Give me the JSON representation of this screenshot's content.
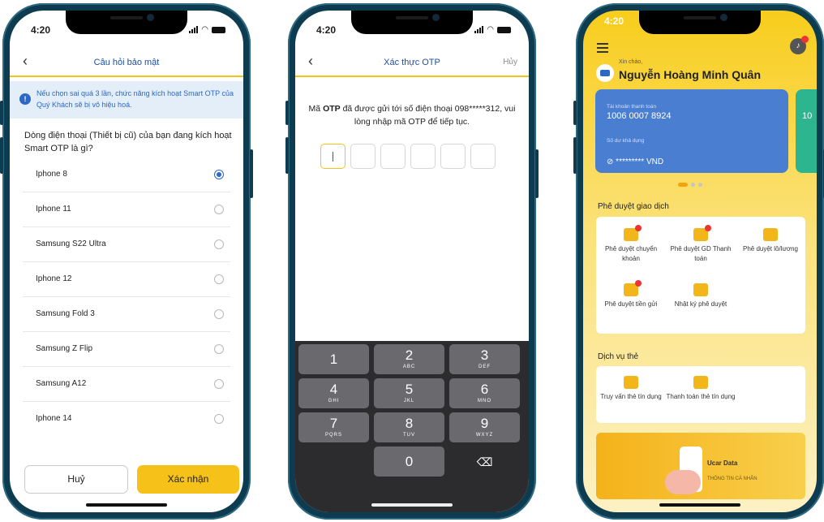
{
  "phone1": {
    "time": "4:20",
    "title": "Câu hỏi bảo mật",
    "info": "Nếu chọn sai quá 3 lần, chức năng kích hoạt Smart OTP của Quý Khách sẽ bị vô hiệu hoá.",
    "question": "Dòng điện thoại (Thiết bị cũ) của bạn đang kích hoạt Smart OTP là gì?",
    "options": [
      "Iphone 8",
      "Iphone 11",
      "Samsung S22 Ultra",
      "Iphone 12",
      "Samsung Fold 3",
      "Samsung Z Flip",
      "Samsung A12",
      "Iphone 14"
    ],
    "selected_option": "Iphone 8",
    "cancel_label": "Huỷ",
    "confirm_label": "Xác nhận"
  },
  "phone2": {
    "time": "4:20",
    "title": "Xác thực OTP",
    "cancel_label": "Hủy",
    "msg_prefix": "Mã ",
    "msg_bold": "OTP",
    "msg_rest": " đã được gửi tới số điện thoại 098*****312, vui lòng nhập mã OTP để tiếp tục.",
    "keys": [
      {
        "num": "1",
        "letters": ""
      },
      {
        "num": "2",
        "letters": "ABC"
      },
      {
        "num": "3",
        "letters": "DEF"
      },
      {
        "num": "4",
        "letters": "GHI"
      },
      {
        "num": "5",
        "letters": "JKL"
      },
      {
        "num": "6",
        "letters": "MNO"
      },
      {
        "num": "7",
        "letters": "PQRS"
      },
      {
        "num": "8",
        "letters": "TUV"
      },
      {
        "num": "9",
        "letters": "WXYZ"
      },
      {
        "num": "0",
        "letters": ""
      }
    ]
  },
  "phone3": {
    "time": "4:20",
    "greeting": "Xin chào,",
    "user_name": "Nguyễn Hoàng Minh Quân",
    "account_label": "Tài khoản thanh toán",
    "account_number": "1006 0007 8924",
    "balance_label": "Số dư khả dụng",
    "balance_masked": "********* VND",
    "card2_number": "10",
    "approve_title": "Phê duyệt giao dịch",
    "approve_tiles": [
      "Phê duyệt chuyển khoản",
      "Phê duyệt GD Thanh toán",
      "Phê duyệt lô/lương",
      "Phê duyệt tiền gửi",
      "Nhật ký phê duyệt"
    ],
    "card_title": "Dịch vụ thẻ",
    "card_tiles": [
      "Truy vấn thẻ tín dụng",
      "Thanh toán thẻ tín dụng"
    ],
    "banner_title": "Ucar Data",
    "banner_sub": "THÔNG TIN CÁ NHÂN"
  },
  "colors": {
    "accent": "#f6c21a",
    "primary_blue": "#2d68c4",
    "frame": "#0d3b4f"
  }
}
